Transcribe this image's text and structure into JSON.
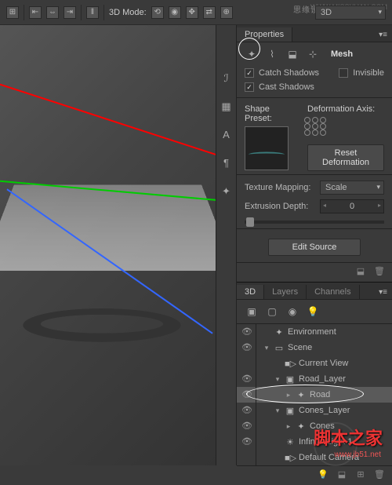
{
  "watermark_top": "思缘设计论坛",
  "watermark_top_url": "WWW.MISSYUAN.COM",
  "topbar": {
    "mode_label": "3D Mode:",
    "dropdown": "3D"
  },
  "properties": {
    "tab": "Properties",
    "mesh_label": "Mesh",
    "catch_shadows": "Catch Shadows",
    "invisible": "Invisible",
    "cast_shadows": "Cast Shadows",
    "shape_preset": "Shape Preset:",
    "deformation_axis": "Deformation Axis:",
    "reset_deformation": "Reset Deformation",
    "texture_mapping": "Texture Mapping:",
    "texture_mapping_value": "Scale",
    "extrusion_depth": "Extrusion Depth:",
    "extrusion_value": "0",
    "edit_source": "Edit Source"
  },
  "panel3d": {
    "tabs": [
      "3D",
      "Layers",
      "Channels"
    ],
    "items": [
      {
        "indent": 0,
        "icon": "✦",
        "label": "Environment",
        "eye": true
      },
      {
        "indent": 0,
        "icon": "▭",
        "label": "Scene",
        "eye": true,
        "tw": "▾"
      },
      {
        "indent": 1,
        "icon": "■▷",
        "label": "Current View",
        "eye": false
      },
      {
        "indent": 1,
        "icon": "▣",
        "label": "Road_Layer",
        "eye": true,
        "tw": "▾"
      },
      {
        "indent": 2,
        "icon": "✦",
        "label": "Road",
        "eye": true,
        "tw": "▸",
        "sel": true
      },
      {
        "indent": 1,
        "icon": "▣",
        "label": "Cones_Layer",
        "eye": true,
        "tw": "▾"
      },
      {
        "indent": 2,
        "icon": "✦",
        "label": "Cones",
        "eye": true,
        "tw": "▸"
      },
      {
        "indent": 1,
        "icon": "☀",
        "label": "Infinite Light 1",
        "eye": true
      },
      {
        "indent": 1,
        "icon": "■▷",
        "label": "Default Camera",
        "eye": false
      }
    ]
  },
  "watermark_cn": "脚本之家",
  "watermark_url": "www.jb51.net"
}
